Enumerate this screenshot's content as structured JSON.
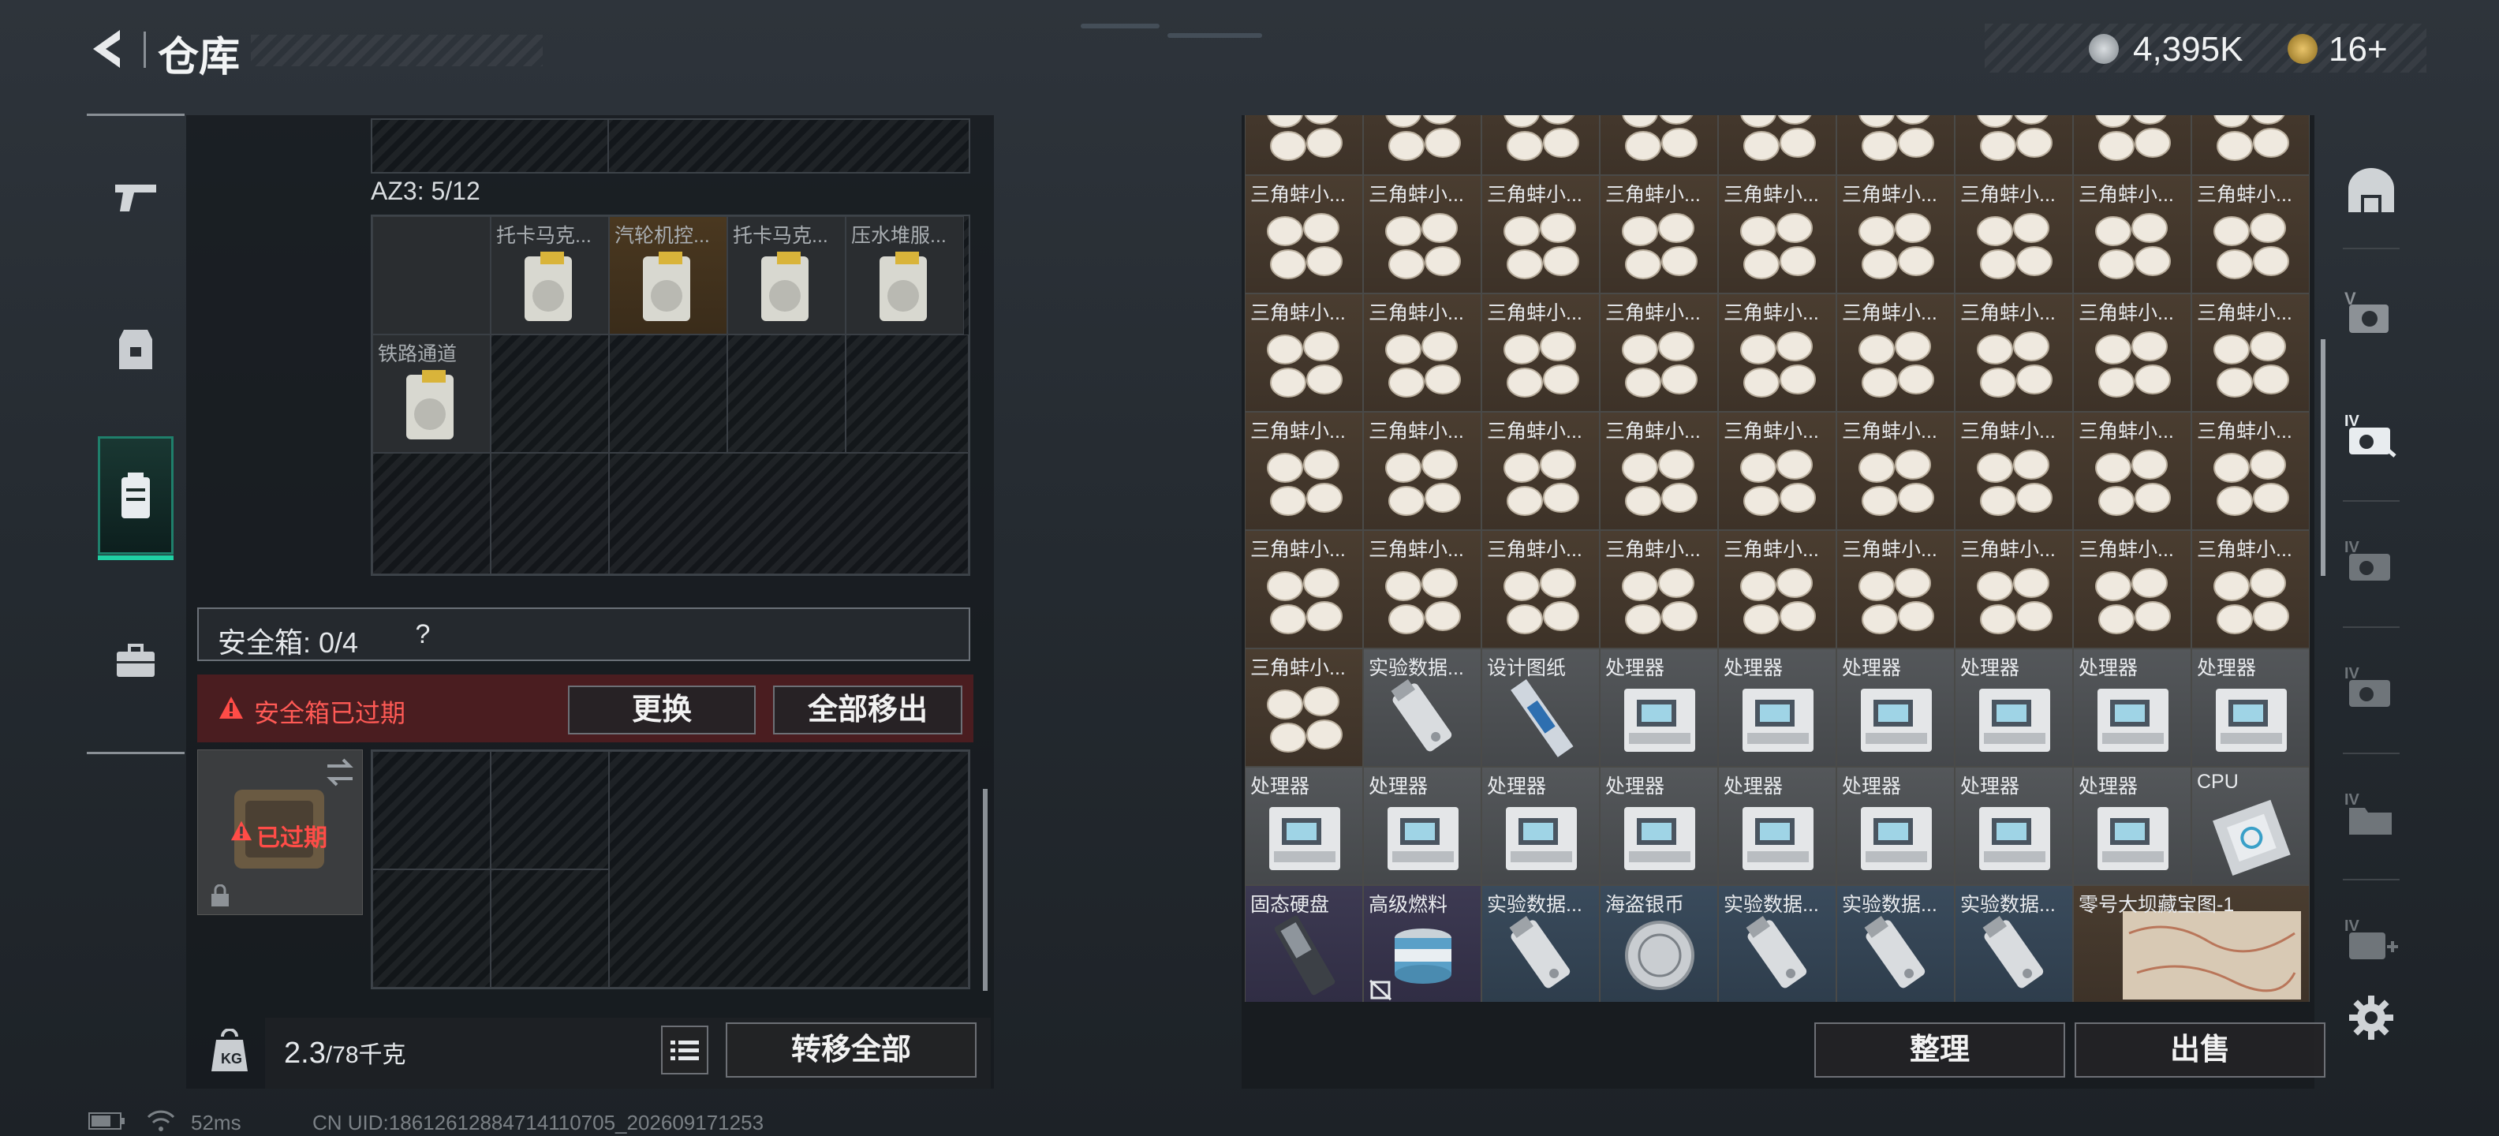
{
  "header": {
    "title": "仓库",
    "currencies": [
      {
        "icon": "silver-coin-icon",
        "value": "4,395K"
      },
      {
        "icon": "gold-triangle-coin-icon",
        "value": "16+"
      }
    ]
  },
  "left_nav": [
    "pistol-icon",
    "armor-vest-icon",
    "backpack-icon",
    "briefcase-icon"
  ],
  "az3": {
    "label": "AZ3: 5/12",
    "items": [
      {
        "label": "托卡马克..."
      },
      {
        "label": "汽轮机控..."
      },
      {
        "label": "托卡马克..."
      },
      {
        "label": "压水堆服..."
      },
      {
        "label": "铁路通道"
      }
    ]
  },
  "safebox": {
    "label": "安全箱: 0/4",
    "help": "?",
    "expired_text": "安全箱已过期",
    "replace_button": "更换",
    "remove_all_button": "全部移出",
    "slot_expired": "已过期"
  },
  "left_bottom": {
    "weight_current": "2.3",
    "weight_max": "/78千克",
    "transfer_all_button": "转移全部"
  },
  "stash": {
    "pearl_label": "三角蚌小...",
    "rows": [
      [
        "三角蚌小...",
        "实验数据...",
        "设计图纸",
        "处理器",
        "处理器",
        "处理器",
        "处理器",
        "处理器",
        "处理器"
      ],
      [
        "处理器",
        "处理器",
        "处理器",
        "处理器",
        "处理器",
        "处理器",
        "处理器",
        "处理器",
        "CPU"
      ],
      [
        "固态硬盘",
        "高级燃料",
        "实验数据...",
        "海盗银币",
        "实验数据...",
        "实验数据...",
        "实验数据...",
        "零号大坝藏宝图-1"
      ]
    ],
    "sort_button": "整理",
    "sell_button": "出售"
  },
  "right_nav": [
    "helmet-icon",
    "v-scanner-icon",
    "iv-hand-tool-icon",
    "iv-hand-tool-icon",
    "iv-hand-tool-icon",
    "iv-folder-icon",
    "iv-add-icon"
  ],
  "footer": {
    "ping": "52ms",
    "uid": "CN UID:18612612884714110705_202609171253"
  }
}
